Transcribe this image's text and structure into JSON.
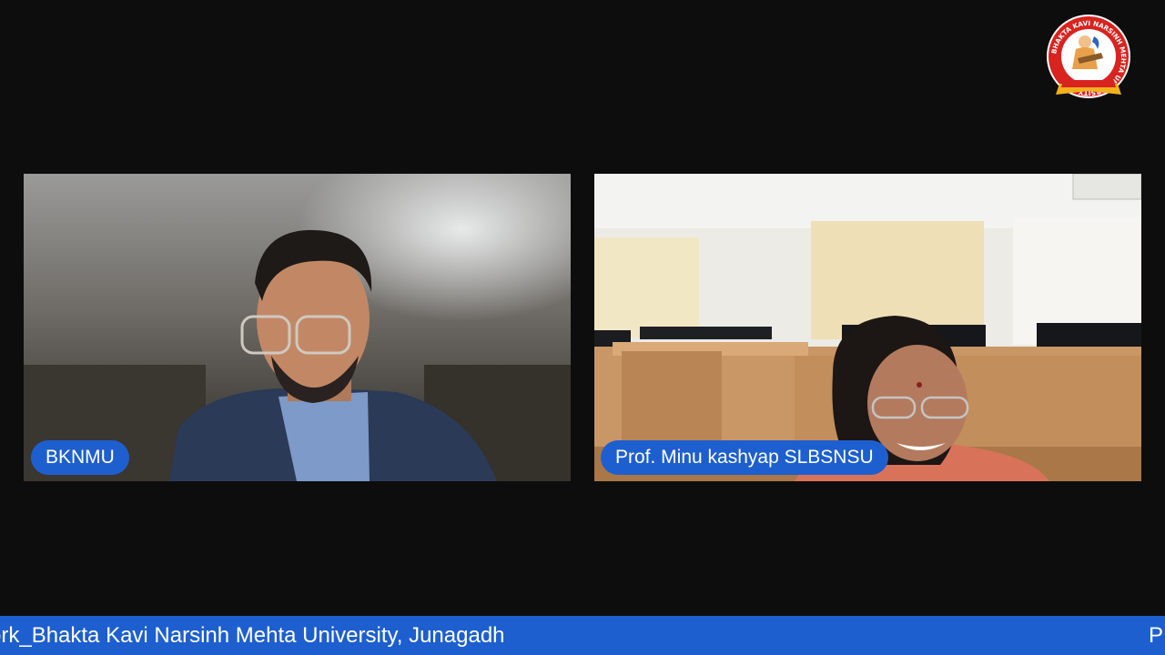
{
  "participants": [
    {
      "name": "BKNMU"
    },
    {
      "name": "Prof. Minu kashyap SLBSNSU"
    }
  ],
  "ticker": {
    "text": "ork_Bhakta Kavi Narsinh Mehta University, Junagadh",
    "tail": "P"
  },
  "logo": {
    "ring_text": "BHAKTA KAVI NARSINH MEHTA UNIVERSITY",
    "icon": "university-emblem-icon"
  },
  "colors": {
    "background": "#0d0d0d",
    "accent_blue": "#1e5fcf",
    "logo_red": "#d8231f",
    "logo_gold": "#f2b01e"
  }
}
